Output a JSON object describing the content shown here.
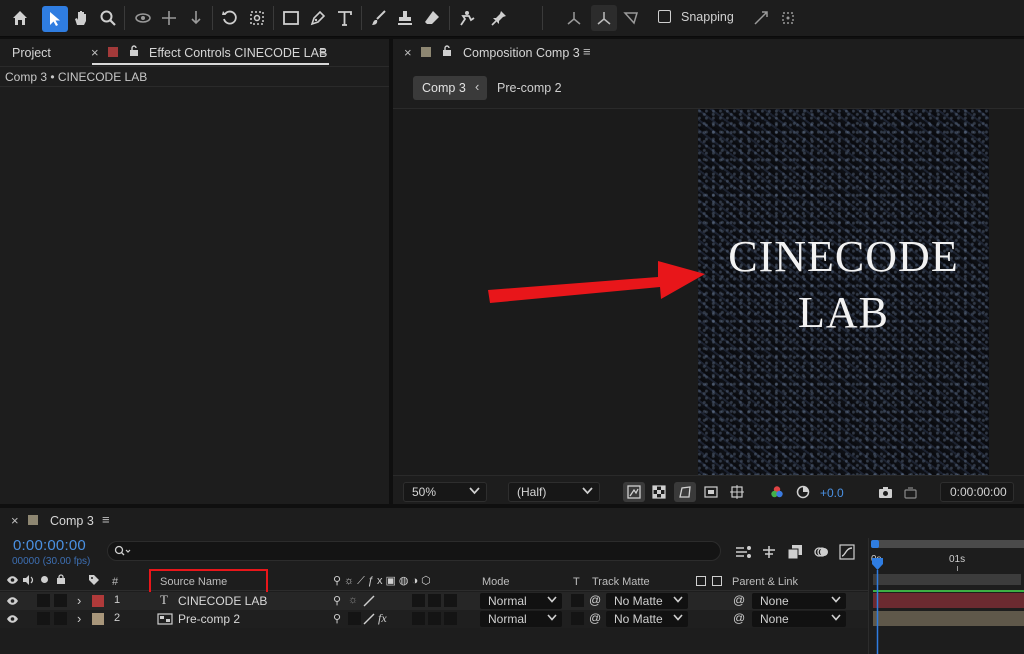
{
  "toolbar": {
    "tools": [
      "home-icon",
      "selection-tool-icon",
      "hand-tool-icon",
      "zoom-tool-icon",
      "orbit-camera-icon",
      "pan-camera-icon",
      "dolly-camera-icon",
      "rotation-tool-icon",
      "anchor-point-icon",
      "rectangle-tool-icon",
      "pen-tool-icon",
      "type-tool-icon",
      "brush-tool-icon",
      "clone-stamp-icon",
      "eraser-tool-icon",
      "roto-brush-icon",
      "puppet-pin-icon"
    ],
    "snapping_label": "Snapping"
  },
  "left_panel": {
    "tab_project": "Project",
    "tab_effect_controls": "Effect Controls CINECODE LAB",
    "breadcrumb": "Comp 3 • CINECODE LAB"
  },
  "comp_panel": {
    "tab_title": "Composition Comp 3",
    "nav_tabs": [
      "Comp 3",
      "Pre-comp 2"
    ],
    "canvas_text_line1": "CINECODE",
    "canvas_text_line2": "LAB",
    "zoom": "50%",
    "resolution": "(Half)",
    "exposure": "+0.0",
    "timecode": "0:00:00:00"
  },
  "timeline": {
    "tab_title": "Comp 3",
    "timecode": "0:00:00:00",
    "frame_info": "00000 (30.00 fps)",
    "search_placeholder": "",
    "columns": {
      "number": "#",
      "source_name": "Source Name",
      "mode": "Mode",
      "t": "T",
      "track_matte": "Track Matte",
      "parent_link": "Parent & Link"
    },
    "ruler": [
      "0s",
      "01s"
    ],
    "layers": [
      {
        "index": "1",
        "name": "CINECODE LAB",
        "type": "text",
        "color": "#b03a3a",
        "mode": "Normal",
        "matte": "No Matte",
        "parent": "None",
        "bar_color": "#6b2a30"
      },
      {
        "index": "2",
        "name": "Pre-comp 2",
        "type": "comp",
        "color": "#a8967a",
        "mode": "Normal",
        "matte": "No Matte",
        "parent": "None",
        "bar_color": "#5f584a"
      }
    ]
  },
  "colors": {
    "accent_blue": "#2f7de1",
    "timecode_blue": "#4a90e2",
    "annotation_red": "#e8161a",
    "work_area_green": "#3cb043"
  }
}
